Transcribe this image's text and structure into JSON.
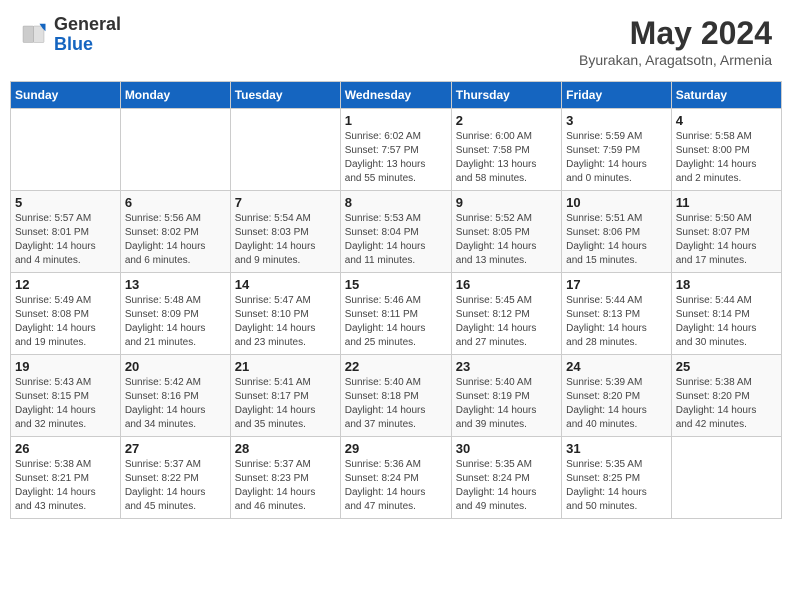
{
  "header": {
    "logo_general": "General",
    "logo_blue": "Blue",
    "month": "May 2024",
    "location": "Byurakan, Aragatsotn, Armenia"
  },
  "days_of_week": [
    "Sunday",
    "Monday",
    "Tuesday",
    "Wednesday",
    "Thursday",
    "Friday",
    "Saturday"
  ],
  "weeks": [
    [
      {
        "day": "",
        "info": ""
      },
      {
        "day": "",
        "info": ""
      },
      {
        "day": "",
        "info": ""
      },
      {
        "day": "1",
        "info": "Sunrise: 6:02 AM\nSunset: 7:57 PM\nDaylight: 13 hours\nand 55 minutes."
      },
      {
        "day": "2",
        "info": "Sunrise: 6:00 AM\nSunset: 7:58 PM\nDaylight: 13 hours\nand 58 minutes."
      },
      {
        "day": "3",
        "info": "Sunrise: 5:59 AM\nSunset: 7:59 PM\nDaylight: 14 hours\nand 0 minutes."
      },
      {
        "day": "4",
        "info": "Sunrise: 5:58 AM\nSunset: 8:00 PM\nDaylight: 14 hours\nand 2 minutes."
      }
    ],
    [
      {
        "day": "5",
        "info": "Sunrise: 5:57 AM\nSunset: 8:01 PM\nDaylight: 14 hours\nand 4 minutes."
      },
      {
        "day": "6",
        "info": "Sunrise: 5:56 AM\nSunset: 8:02 PM\nDaylight: 14 hours\nand 6 minutes."
      },
      {
        "day": "7",
        "info": "Sunrise: 5:54 AM\nSunset: 8:03 PM\nDaylight: 14 hours\nand 9 minutes."
      },
      {
        "day": "8",
        "info": "Sunrise: 5:53 AM\nSunset: 8:04 PM\nDaylight: 14 hours\nand 11 minutes."
      },
      {
        "day": "9",
        "info": "Sunrise: 5:52 AM\nSunset: 8:05 PM\nDaylight: 14 hours\nand 13 minutes."
      },
      {
        "day": "10",
        "info": "Sunrise: 5:51 AM\nSunset: 8:06 PM\nDaylight: 14 hours\nand 15 minutes."
      },
      {
        "day": "11",
        "info": "Sunrise: 5:50 AM\nSunset: 8:07 PM\nDaylight: 14 hours\nand 17 minutes."
      }
    ],
    [
      {
        "day": "12",
        "info": "Sunrise: 5:49 AM\nSunset: 8:08 PM\nDaylight: 14 hours\nand 19 minutes."
      },
      {
        "day": "13",
        "info": "Sunrise: 5:48 AM\nSunset: 8:09 PM\nDaylight: 14 hours\nand 21 minutes."
      },
      {
        "day": "14",
        "info": "Sunrise: 5:47 AM\nSunset: 8:10 PM\nDaylight: 14 hours\nand 23 minutes."
      },
      {
        "day": "15",
        "info": "Sunrise: 5:46 AM\nSunset: 8:11 PM\nDaylight: 14 hours\nand 25 minutes."
      },
      {
        "day": "16",
        "info": "Sunrise: 5:45 AM\nSunset: 8:12 PM\nDaylight: 14 hours\nand 27 minutes."
      },
      {
        "day": "17",
        "info": "Sunrise: 5:44 AM\nSunset: 8:13 PM\nDaylight: 14 hours\nand 28 minutes."
      },
      {
        "day": "18",
        "info": "Sunrise: 5:44 AM\nSunset: 8:14 PM\nDaylight: 14 hours\nand 30 minutes."
      }
    ],
    [
      {
        "day": "19",
        "info": "Sunrise: 5:43 AM\nSunset: 8:15 PM\nDaylight: 14 hours\nand 32 minutes."
      },
      {
        "day": "20",
        "info": "Sunrise: 5:42 AM\nSunset: 8:16 PM\nDaylight: 14 hours\nand 34 minutes."
      },
      {
        "day": "21",
        "info": "Sunrise: 5:41 AM\nSunset: 8:17 PM\nDaylight: 14 hours\nand 35 minutes."
      },
      {
        "day": "22",
        "info": "Sunrise: 5:40 AM\nSunset: 8:18 PM\nDaylight: 14 hours\nand 37 minutes."
      },
      {
        "day": "23",
        "info": "Sunrise: 5:40 AM\nSunset: 8:19 PM\nDaylight: 14 hours\nand 39 minutes."
      },
      {
        "day": "24",
        "info": "Sunrise: 5:39 AM\nSunset: 8:20 PM\nDaylight: 14 hours\nand 40 minutes."
      },
      {
        "day": "25",
        "info": "Sunrise: 5:38 AM\nSunset: 8:20 PM\nDaylight: 14 hours\nand 42 minutes."
      }
    ],
    [
      {
        "day": "26",
        "info": "Sunrise: 5:38 AM\nSunset: 8:21 PM\nDaylight: 14 hours\nand 43 minutes."
      },
      {
        "day": "27",
        "info": "Sunrise: 5:37 AM\nSunset: 8:22 PM\nDaylight: 14 hours\nand 45 minutes."
      },
      {
        "day": "28",
        "info": "Sunrise: 5:37 AM\nSunset: 8:23 PM\nDaylight: 14 hours\nand 46 minutes."
      },
      {
        "day": "29",
        "info": "Sunrise: 5:36 AM\nSunset: 8:24 PM\nDaylight: 14 hours\nand 47 minutes."
      },
      {
        "day": "30",
        "info": "Sunrise: 5:35 AM\nSunset: 8:24 PM\nDaylight: 14 hours\nand 49 minutes."
      },
      {
        "day": "31",
        "info": "Sunrise: 5:35 AM\nSunset: 8:25 PM\nDaylight: 14 hours\nand 50 minutes."
      },
      {
        "day": "",
        "info": ""
      }
    ]
  ]
}
